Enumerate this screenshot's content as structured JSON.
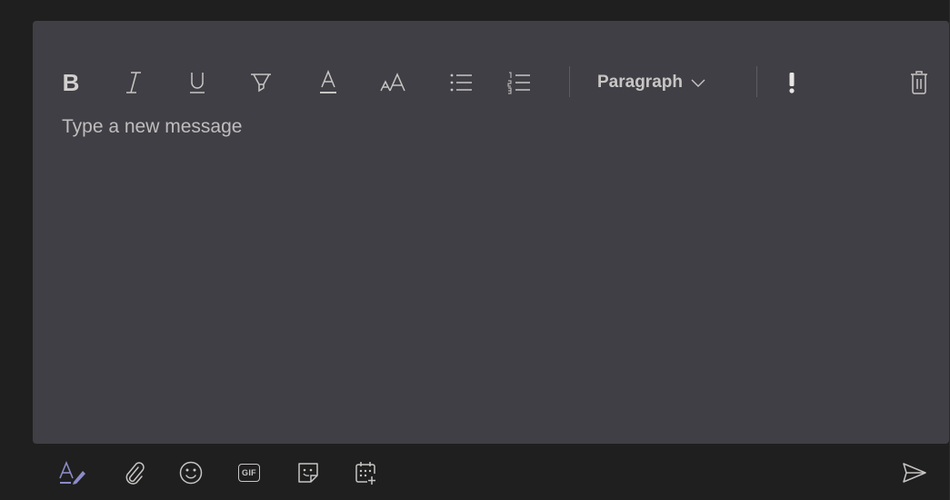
{
  "composer": {
    "placeholder": "Type a new message",
    "paragraph_label": "Paragraph"
  },
  "toolbar": {
    "bold_label": "B",
    "items": [
      {
        "name": "bold",
        "icon": "bold-icon"
      },
      {
        "name": "italic",
        "icon": "italic-icon"
      },
      {
        "name": "underline",
        "icon": "underline-icon"
      },
      {
        "name": "highlight",
        "icon": "highlight-icon"
      },
      {
        "name": "font-color",
        "icon": "font-color-icon"
      },
      {
        "name": "font-size",
        "icon": "font-size-icon"
      },
      {
        "name": "bulleted-list",
        "icon": "bulleted-list-icon"
      },
      {
        "name": "numbered-list",
        "icon": "numbered-list-icon"
      },
      {
        "name": "paragraph",
        "icon": "chevron-down-icon"
      },
      {
        "name": "important",
        "icon": "exclamation-icon"
      },
      {
        "name": "discard",
        "icon": "trash-icon"
      }
    ]
  },
  "bottom_bar": {
    "items": [
      {
        "name": "format",
        "icon": "format-icon"
      },
      {
        "name": "attach",
        "icon": "paperclip-icon"
      },
      {
        "name": "emoji",
        "icon": "emoji-icon"
      },
      {
        "name": "gif",
        "icon": "gif-icon"
      },
      {
        "name": "sticker",
        "icon": "sticker-icon"
      },
      {
        "name": "schedule-meeting",
        "icon": "calendar-icon"
      },
      {
        "name": "send",
        "icon": "send-icon"
      }
    ],
    "gif_label": "GIF"
  },
  "colors": {
    "background": "#1f1f1f",
    "composer": "#403f45",
    "icon": "#c8c6c4",
    "placeholder": "#bfbdbd",
    "accent": "#8b8cc7"
  }
}
